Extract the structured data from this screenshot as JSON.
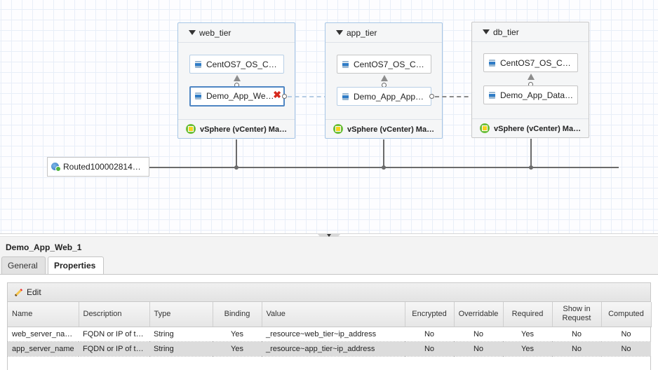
{
  "canvas": {
    "tiers": [
      {
        "label": "web_tier",
        "top_node": "CentOS7_OS_C…",
        "bottom_node": "Demo_App_We…",
        "footer": "vSphere (vCenter) Ma…",
        "bottom_selected": true
      },
      {
        "label": "app_tier",
        "top_node": "CentOS7_OS_C…",
        "bottom_node": "Demo_App_App…",
        "footer": "vSphere (vCenter) Ma…",
        "bottom_selected": false
      },
      {
        "label": "db_tier",
        "top_node": "CentOS7_OS_C…",
        "bottom_node": "Demo_App_Data…",
        "footer": "vSphere (vCenter) Ma…",
        "bottom_selected": false
      }
    ],
    "network": {
      "label": "Routed100002814…"
    }
  },
  "details": {
    "title": "Demo_App_Web_1",
    "tabs": [
      {
        "label": "General",
        "active": false
      },
      {
        "label": "Properties",
        "active": true
      }
    ],
    "toolbar": {
      "edit_label": "Edit"
    },
    "columns": [
      "Name",
      "Description",
      "Type",
      "Binding",
      "Value",
      "Encrypted",
      "Overridable",
      "Required",
      "Show in Request",
      "Computed"
    ],
    "rows": [
      {
        "name": "web_server_na…",
        "description": "FQDN or IP of t…",
        "type": "String",
        "binding": "Yes",
        "value": "_resource~web_tier~ip_address",
        "encrypted": "No",
        "overridable": "No",
        "required": "Yes",
        "show_in_request": "No",
        "computed": "No"
      },
      {
        "name": "app_server_name",
        "description": "FQDN or IP of t…",
        "type": "String",
        "binding": "Yes",
        "value": "_resource~app_tier~ip_address",
        "encrypted": "No",
        "overridable": "No",
        "required": "Yes",
        "show_in_request": "No",
        "computed": "No"
      }
    ]
  }
}
